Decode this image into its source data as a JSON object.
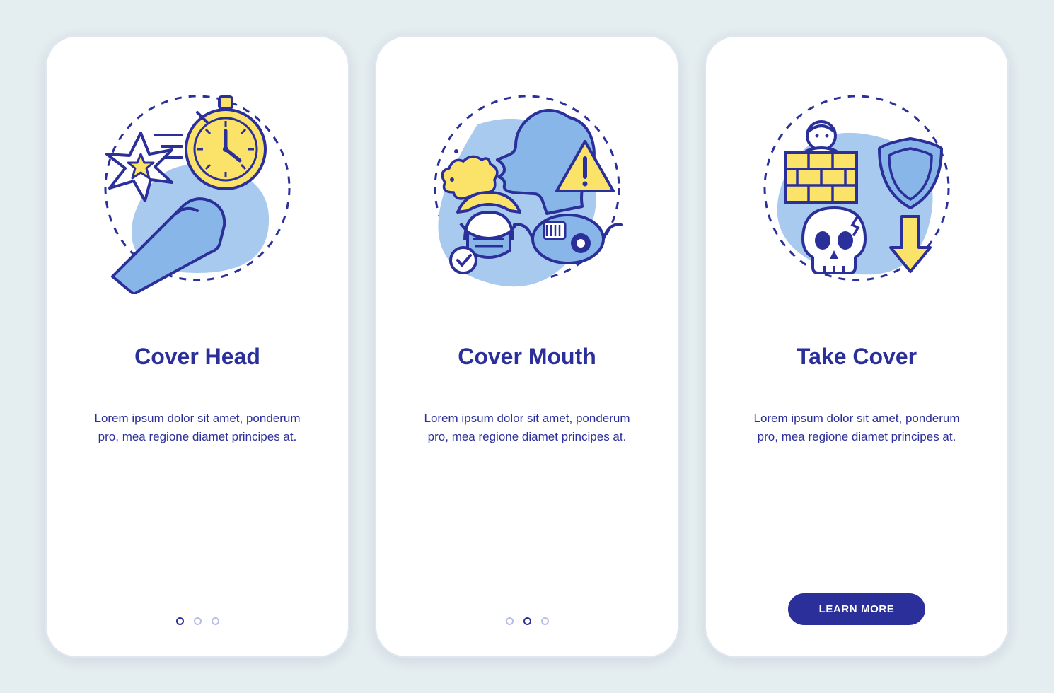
{
  "colors": {
    "stroke": "#2b2f9a",
    "yellow": "#fbe36a",
    "blue": "#a9caef",
    "bluefill": "#88b6e8",
    "white": "#ffffff"
  },
  "screens": [
    {
      "icon": "cover-head",
      "title": "Cover Head",
      "desc": "Lorem ipsum dolor sit amet, ponderum pro, mea regione diamet principes at.",
      "page": 0,
      "totalPages": 3,
      "cta": null
    },
    {
      "icon": "cover-mouth",
      "title": "Cover Mouth",
      "desc": "Lorem ipsum dolor sit amet, ponderum pro, mea regione diamet principes at.",
      "page": 1,
      "totalPages": 3,
      "cta": null
    },
    {
      "icon": "take-cover",
      "title": "Take Cover",
      "desc": "Lorem ipsum dolor sit amet, ponderum pro, mea regione diamet principes at.",
      "page": 2,
      "totalPages": 3,
      "cta": "LEARN MORE"
    }
  ]
}
